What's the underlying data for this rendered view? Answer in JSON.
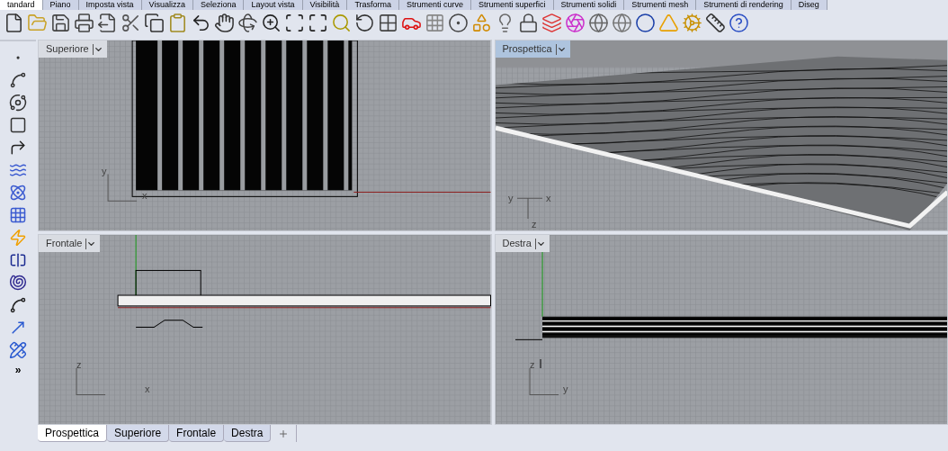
{
  "ribbon_tabs": [
    {
      "label": "tandard",
      "selected": true
    },
    {
      "label": "Piano",
      "selected": false
    },
    {
      "label": "Imposta vista",
      "selected": false
    },
    {
      "label": "Visualizza",
      "selected": false
    },
    {
      "label": "Seleziona",
      "selected": false
    },
    {
      "label": "Layout vista",
      "selected": false
    },
    {
      "label": "Visibilità",
      "selected": false
    },
    {
      "label": "Trasforma",
      "selected": false
    },
    {
      "label": "Strumenti curve",
      "selected": false
    },
    {
      "label": "Strumenti superfici",
      "selected": false
    },
    {
      "label": "Strumenti solidi",
      "selected": false
    },
    {
      "label": "Strumenti mesh",
      "selected": false
    },
    {
      "label": "Strumenti di rendering",
      "selected": false
    },
    {
      "label": "Diseg",
      "selected": false
    }
  ],
  "left_toolbar": {
    "more": "»"
  },
  "viewports": [
    {
      "title": "Superiore",
      "selected": false,
      "kind": "top",
      "axes": [
        "y",
        "x"
      ]
    },
    {
      "title": "Prospettica",
      "selected": true,
      "kind": "perspective",
      "axes": [
        "y",
        "x",
        "z"
      ]
    },
    {
      "title": "Frontale",
      "selected": false,
      "kind": "front",
      "axes": [
        "z",
        "x"
      ]
    },
    {
      "title": "Destra",
      "selected": false,
      "kind": "right",
      "axes": [
        "z",
        "y"
      ]
    }
  ],
  "viewport_tabs": [
    {
      "label": "Prospettica",
      "selected": true
    },
    {
      "label": "Superiore",
      "selected": false
    },
    {
      "label": "Frontale",
      "selected": false
    },
    {
      "label": "Destra",
      "selected": false
    }
  ]
}
